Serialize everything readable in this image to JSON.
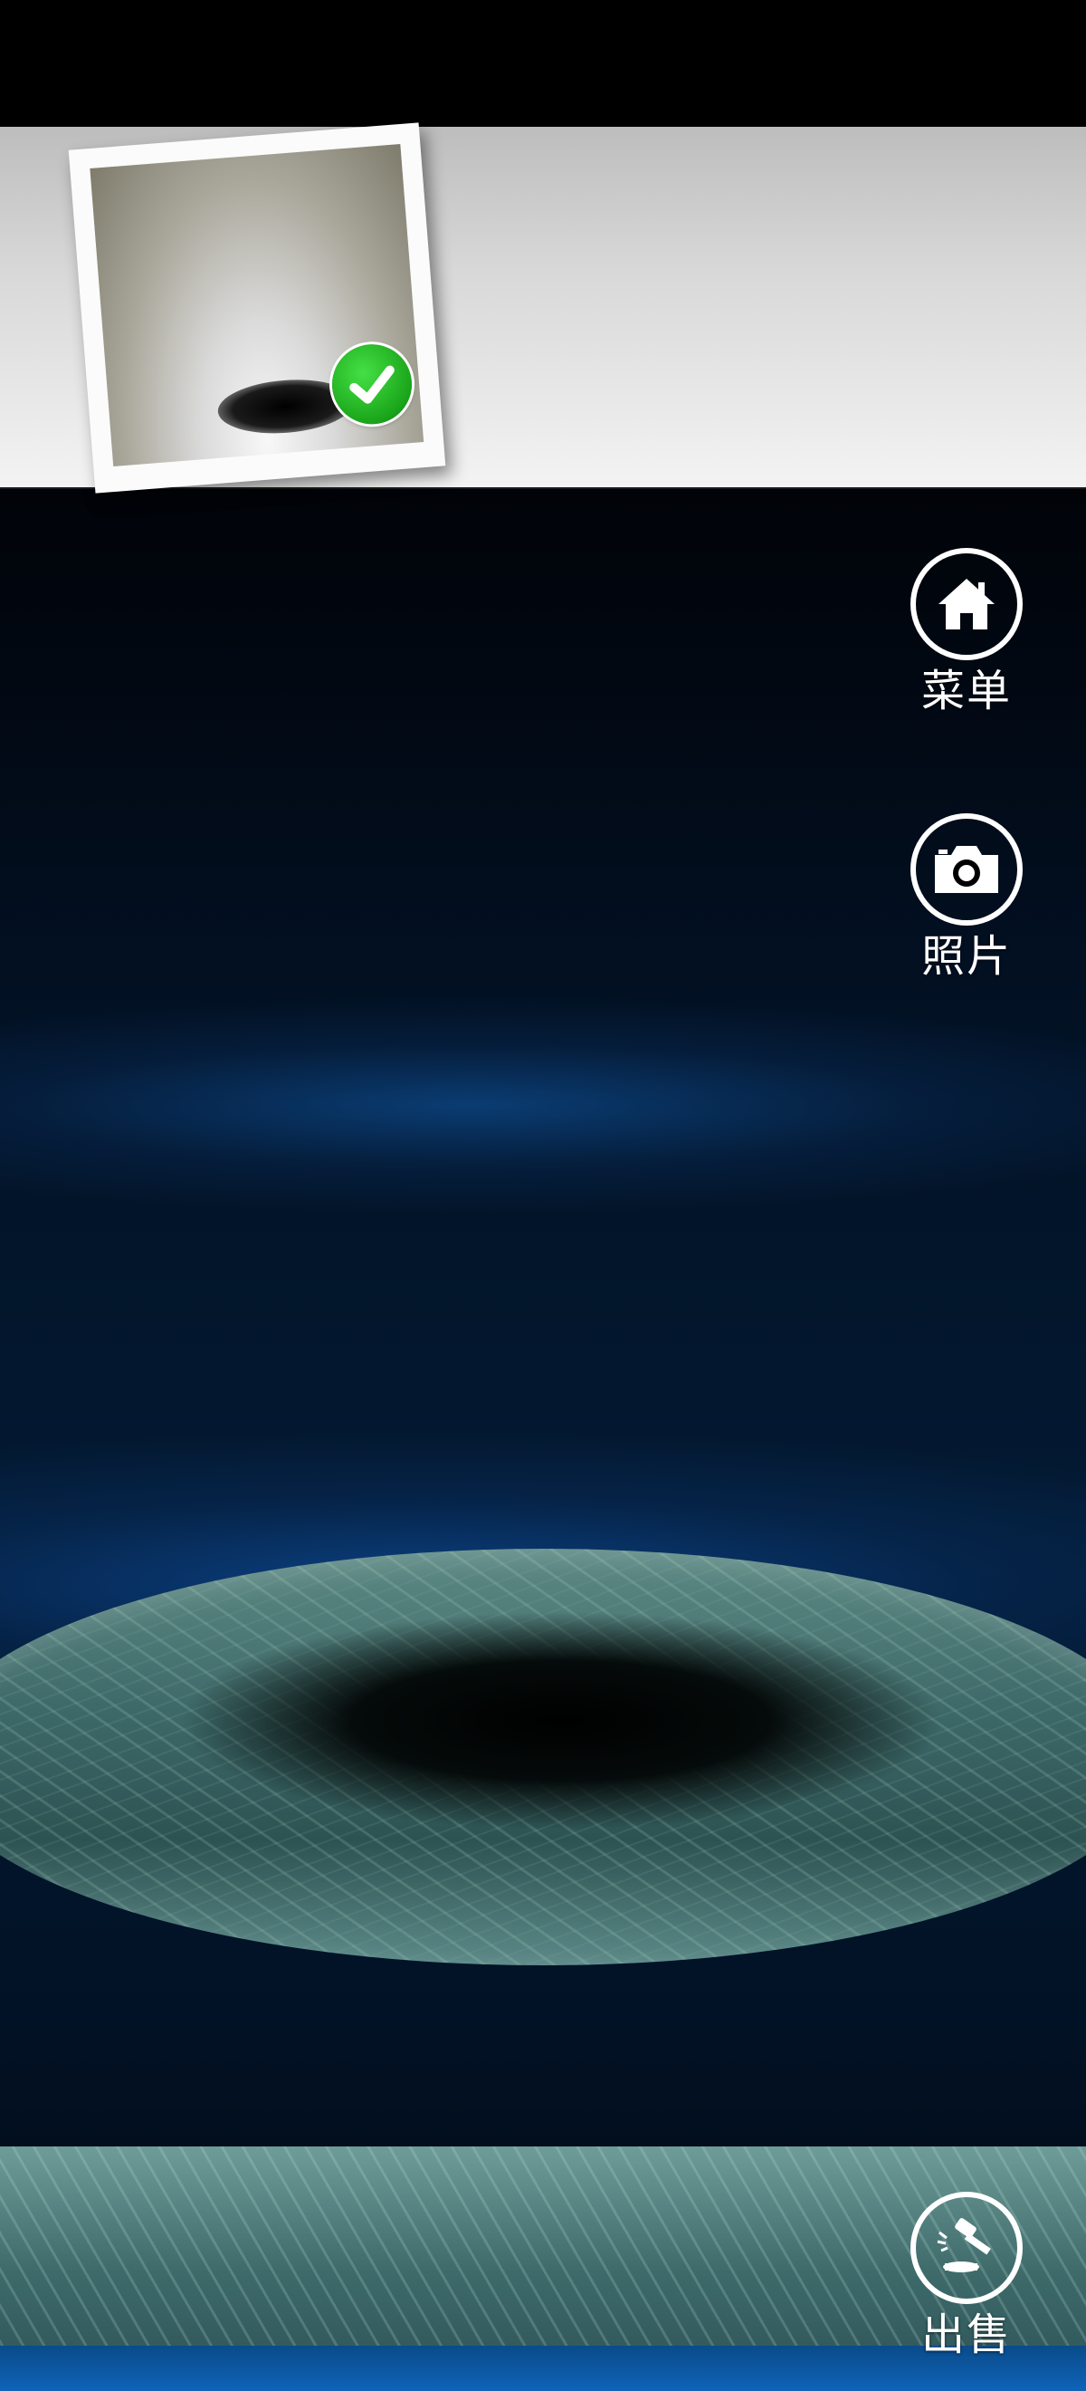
{
  "photo": {
    "selected": true
  },
  "buttons": {
    "menu": {
      "label": "菜单",
      "icon": "home-icon"
    },
    "photos": {
      "label": "照片",
      "icon": "camera-icon"
    },
    "sell": {
      "label": "出售",
      "icon": "gavel-icon"
    }
  },
  "colors": {
    "background_top": "#010308",
    "background_glow": "#0d4a8c",
    "photo_strip": "#e0e0e0",
    "check_badge": "#1aa51a",
    "button_ring": "#ffffff",
    "pedestal_marble": "#3d6868"
  }
}
